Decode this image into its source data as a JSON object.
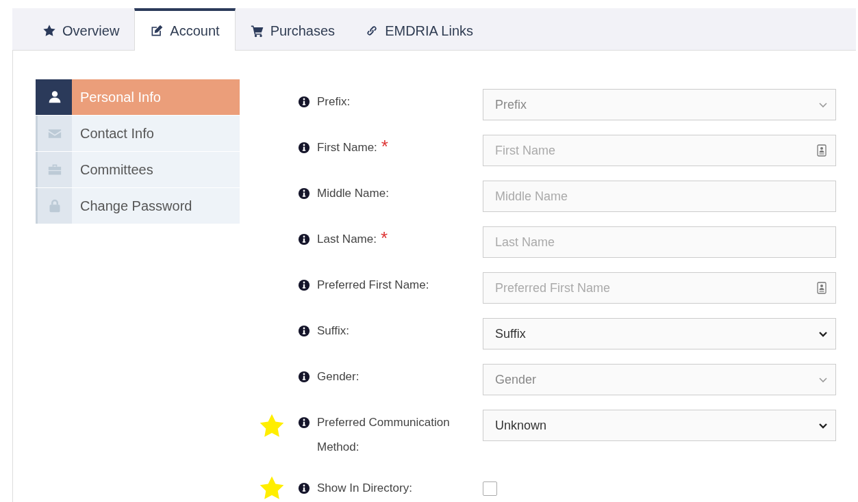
{
  "tabs": [
    {
      "label": "Overview",
      "selected": false
    },
    {
      "label": "Account",
      "selected": true
    },
    {
      "label": "Purchases",
      "selected": false
    },
    {
      "label": "EMDRIA Links",
      "selected": false
    }
  ],
  "sidebar": {
    "items": [
      {
        "label": "Personal Info",
        "selected": true
      },
      {
        "label": "Contact Info",
        "selected": false
      },
      {
        "label": "Committees",
        "selected": false
      },
      {
        "label": "Change Password",
        "selected": false
      }
    ]
  },
  "form": {
    "fields": [
      {
        "kind": "select",
        "label": "Prefix:",
        "value": "Prefix",
        "disabled": true,
        "starred": false
      },
      {
        "kind": "text",
        "label": "First Name:",
        "required_mark": "*",
        "placeholder": "First Name",
        "autofill": true,
        "starred": false
      },
      {
        "kind": "text",
        "label": "Middle Name:",
        "placeholder": "Middle Name",
        "autofill": false,
        "starred": false
      },
      {
        "kind": "text",
        "label": "Last Name:",
        "required_mark": "*",
        "placeholder": "Last Name",
        "autofill": false,
        "starred": false
      },
      {
        "kind": "text",
        "label": "Preferred First Name:",
        "placeholder": "Preferred First Name",
        "autofill": true,
        "starred": false
      },
      {
        "kind": "select",
        "label": "Suffix:",
        "value": "Suffix",
        "disabled": false,
        "starred": false
      },
      {
        "kind": "select",
        "label": "Gender:",
        "value": "Gender",
        "disabled": true,
        "starred": false
      },
      {
        "kind": "select",
        "label": "Preferred Communication Method:",
        "value": "Unknown",
        "disabled": false,
        "starred": true
      },
      {
        "kind": "checkbox",
        "label": "Show In Directory:",
        "checked": false,
        "starred": true
      }
    ]
  }
}
